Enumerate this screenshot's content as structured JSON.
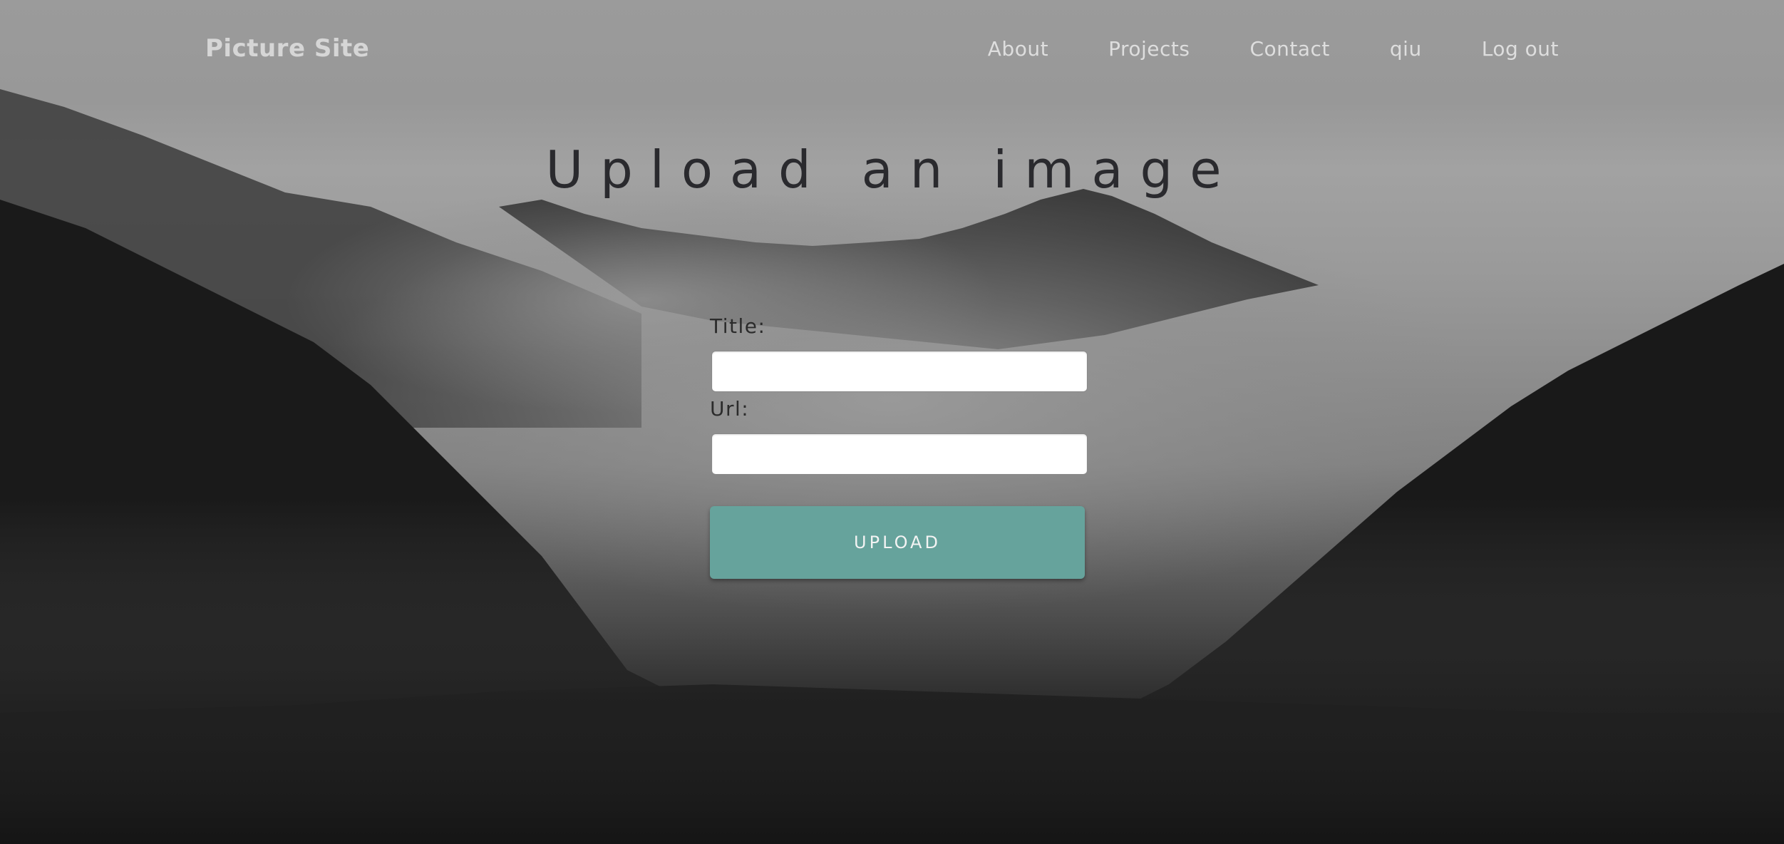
{
  "nav": {
    "brand": "Picture Site",
    "links": [
      {
        "label": "About"
      },
      {
        "label": "Projects"
      },
      {
        "label": "Contact"
      },
      {
        "label": "qiu"
      },
      {
        "label": "Log out"
      }
    ]
  },
  "main": {
    "title": "Upload an image",
    "form": {
      "title_label": "Title:",
      "title_value": "",
      "url_label": "Url:",
      "url_value": "",
      "submit_label": "UPLOAD"
    }
  },
  "colors": {
    "button": "#66a39c",
    "title_text": "#2a2a2e",
    "nav_text": "#dedede"
  }
}
